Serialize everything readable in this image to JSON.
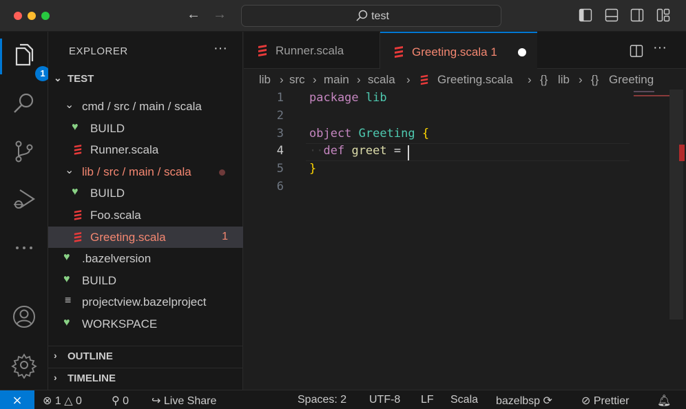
{
  "titlebar": {
    "search_text": "test"
  },
  "activity": {
    "explorer_badge": "1"
  },
  "sidebar": {
    "title": "EXPLORER",
    "more": "···",
    "workspace": "TEST",
    "tree": [
      {
        "label": "cmd / src / main / scala",
        "type": "folder",
        "indent": 1
      },
      {
        "label": "BUILD",
        "type": "bazel",
        "indent": 2
      },
      {
        "label": "Runner.scala",
        "type": "scala",
        "indent": 2
      },
      {
        "label": "lib / src / main / scala",
        "type": "folder",
        "indent": 1,
        "modified": true
      },
      {
        "label": "BUILD",
        "type": "bazel",
        "indent": 2
      },
      {
        "label": "Foo.scala",
        "type": "scala",
        "indent": 2
      },
      {
        "label": "Greeting.scala",
        "type": "scala",
        "indent": 2,
        "problems": "1",
        "selected": true
      },
      {
        "label": ".bazelversion",
        "type": "bazel",
        "indent": 1
      },
      {
        "label": "BUILD",
        "type": "bazel",
        "indent": 1
      },
      {
        "label": "projectview.bazelproject",
        "type": "text",
        "indent": 1
      },
      {
        "label": "WORKSPACE",
        "type": "bazel",
        "indent": 1
      }
    ],
    "outline": "OUTLINE",
    "timeline": "TIMELINE"
  },
  "tabs": [
    {
      "label": "Runner.scala"
    },
    {
      "label": "Greeting.scala 1",
      "active": true,
      "dirty": true
    }
  ],
  "breadcrumb": [
    "lib",
    "src",
    "main",
    "scala",
    "Greeting.scala",
    "lib",
    "Greeting"
  ],
  "editor": {
    "line_numbers": [
      "1",
      "2",
      "3",
      "4",
      "5",
      "6"
    ],
    "current_line": 4,
    "lines": [
      [
        {
          "t": "package",
          "c": "kw"
        },
        {
          "t": " ",
          "c": "plain"
        },
        {
          "t": "lib",
          "c": "ty"
        }
      ],
      [],
      [
        {
          "t": "object",
          "c": "kw"
        },
        {
          "t": " ",
          "c": "plain"
        },
        {
          "t": "Greeting",
          "c": "ty"
        },
        {
          "t": " ",
          "c": "plain"
        },
        {
          "t": "{",
          "c": "br"
        }
      ],
      [
        {
          "t": "··",
          "c": "ws"
        },
        {
          "t": "def",
          "c": "kw"
        },
        {
          "t": " ",
          "c": "plain"
        },
        {
          "t": "greet",
          "c": "id"
        },
        {
          "t": " ",
          "c": "plain"
        },
        {
          "t": "=",
          "c": "plain"
        },
        {
          "t": " ",
          "c": "plain"
        }
      ],
      [
        {
          "t": "}",
          "c": "br"
        }
      ],
      []
    ]
  },
  "statusbar": {
    "errors": "1",
    "warnings": "0",
    "ports": "0",
    "live_share": "Live Share",
    "spaces": "Spaces: 2",
    "encoding": "UTF-8",
    "eol": "LF",
    "language": "Scala",
    "bsp": "bazelbsp",
    "prettier": "Prettier"
  },
  "colors": {
    "accent": "#0078d4",
    "error_text": "#f48771",
    "bazel_heart": "#89d185",
    "scala_icon": "#e63a3a"
  }
}
